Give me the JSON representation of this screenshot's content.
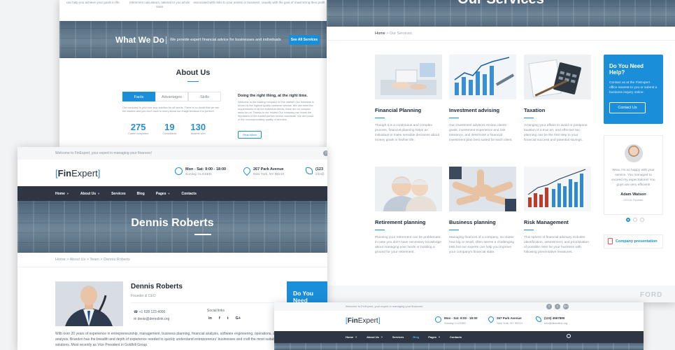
{
  "panel_a": {
    "top_features": [
      "can help you achieve your goals in life",
      "retirement calculators, tailored to you whole team",
      "associated with risks to your assets or business",
      "usually with the goal of maximizing their profit"
    ],
    "what_we_do": {
      "title": "What We Do",
      "text": "We provide expert financial advice for businesses and individuals",
      "button": "See All Services"
    },
    "about": {
      "title": "About Us",
      "tabs": [
        "Facts",
        "Advantages",
        "Skills"
      ],
      "body": "Our company is your one stop solution for all needs. There is no doubt that we are the leaders and you don't have to worry about our image because it is perfect!",
      "stats": [
        {
          "value": "275",
          "label": "Cases completed"
        },
        {
          "value": "19",
          "label": "Consultants"
        },
        {
          "value": "130",
          "label": "Awards won"
        }
      ],
      "right_title": "Doing the right thing, at the right time.",
      "right_body": "Welcome to the leading company on the market! Our business is driven by the highest quality customer service. We can meet the requirements of all the individual clients; there are no complex tasks for us! Thanks to our trusted Our company can boast the reputation of the trusted partner known worldwide. We are proud of the uncompromising quality of services.",
      "read_more": "Read More"
    }
  },
  "panel_b": {
    "hero_title": "Our Services",
    "breadcrumb": {
      "home": "Home",
      "sep": ">",
      "current": "Our Services"
    },
    "services": [
      {
        "title": "Financial Planning",
        "desc": "Though it is a continuous and complex process, financial planning helps an individual to make sensible decisions about money goals in his/her life."
      },
      {
        "title": "Investment advising",
        "desc": "Our investment advisors review clients' goals, investment experience and risk tolerance, and determine a financial investment plan best suited for each client."
      },
      {
        "title": "Taxation",
        "desc": "Arranging your affairs to avoid or postpone taxation is a true art, and effective tax planning can be the first step to your financial success and potential savings."
      },
      {
        "title": "Retirement planning",
        "desc": "Planning your retirement can be problematic in case you don't have necessary knowledge about managing your funds or building a ground for your retirement."
      },
      {
        "title": "Business planning",
        "desc": "Managing finances of a company, no matter how big or small, often seems a challenging task but our experts can help you improve your company's financial state."
      },
      {
        "title": "Risk Management",
        "desc": "This sphere of financial advisory includes identification, assessment, and prioritization of possible risks for your business with following preventative measures."
      }
    ],
    "help": {
      "title": "Do You Need Help?",
      "text": "Contact us at the FinExpert office nearest to you or submit a business inquiry online.",
      "button": "Contact Us"
    },
    "testimonial": {
      "quote": "Wow, I'm so happy with your service. You managed to exceed my expectations! You guys are very efficient!",
      "name": "Adam Watson",
      "role": "CEO & Founder"
    },
    "presentation": "Company presentation",
    "partner_logo": "FORD"
  },
  "panel_c": {
    "topbar_text": "Welcome to FinExpert, your expert in managing your finances!",
    "social_icons": [
      "f",
      "t",
      "G+"
    ],
    "logo": {
      "open": "[",
      "a": "Fin",
      "b": "Expert",
      "close": "]"
    },
    "hours": {
      "main": "Mon - Sat: 9:00 - 18:00",
      "sub": "Sunday CLOSED"
    },
    "address": {
      "main": "267 Park Avenue",
      "sub": "New York, NY 90210"
    },
    "phone": {
      "main": "(123",
      "sub": "info@"
    },
    "nav": [
      "Home",
      "About Us",
      "Services",
      "Blog",
      "Pages",
      "Contacts"
    ],
    "hero_title": "Dennis Roberts",
    "breadcrumb": "Home  >  About Us  >  Team  >  Dennis Roberts",
    "person": {
      "name": "Dennis Roberts",
      "role": "Founder & CEO",
      "phone": "+1 628 123 4000",
      "email": "denis@demolink.org",
      "social_label": "Social links",
      "social_icons": [
        "in",
        "f",
        "t",
        "G+"
      ]
    },
    "bio": "With over 20 years of experience in entrepreneurship, management, business planning, financial analysis, software engineering, operations, and decision analysis, Brandon has the breadth and depth of experience needed to quickly understand entrepreneurs' businesses and craft the most suitable solutions. Most recently as Vice President in Goldhill Group.",
    "help_title": "Do You Need"
  },
  "panel_d": {
    "topbar_text": "Welcome to FinExpert, your expert in managing your finances!",
    "social_icons": [
      "f",
      "t",
      "G+"
    ],
    "logo": {
      "open": "[",
      "a": "Fin",
      "b": "Expert",
      "close": "]"
    },
    "hours": {
      "main": "Mon - Sat: 9:00 - 18:00",
      "sub": "Sunday CLOSED"
    },
    "address": {
      "main": "267 Park Avenue",
      "sub": "New York, NY 90210"
    },
    "phone": {
      "main": "(123) 4567890",
      "sub": "info@demolink.org"
    },
    "nav": [
      "Home",
      "About Us",
      "Services",
      "Blog",
      "Pages",
      "Contacts"
    ]
  },
  "colors": {
    "accent": "#1b8ed9",
    "nav_bg": "#2d3642"
  }
}
